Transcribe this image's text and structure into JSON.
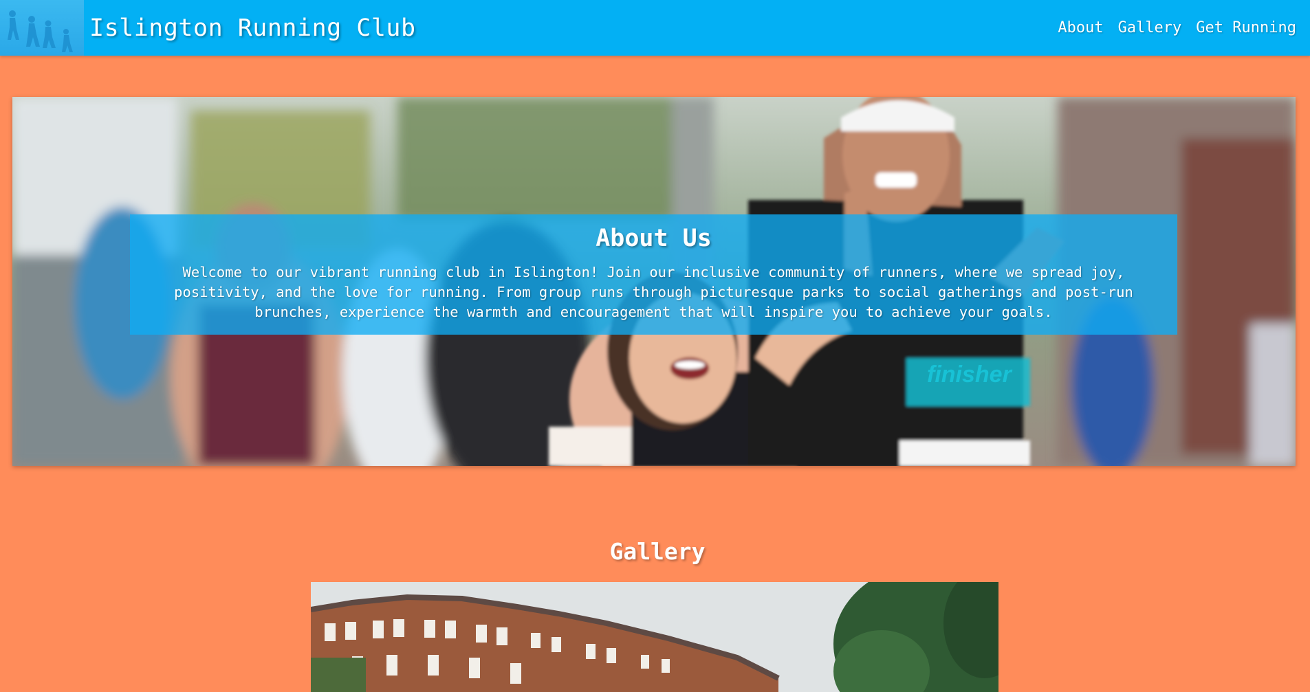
{
  "header": {
    "title": "Islington Running Club",
    "logo_icon": "runners-silhouette-icon",
    "nav": [
      {
        "label": "About"
      },
      {
        "label": "Gallery"
      },
      {
        "label": "Get Running"
      }
    ]
  },
  "about": {
    "heading": "About Us",
    "text": "Welcome to our vibrant running club in Islington! Join our inclusive community of runners, where we spread joy, positivity, and the love for running. From group runs through picturesque parks to social gatherings and post-run brunches, experience the warmth and encouragement that will inspire you to achieve your goals.",
    "hero_image": "smiling-marathon-runners-photo",
    "hero_bib_text": "finisher"
  },
  "gallery": {
    "heading": "Gallery",
    "image": "islington-terraced-houses-photo"
  },
  "colors": {
    "page_background": "#ff8c5a",
    "header_background": "#03b0f4",
    "about_box": "#10acf4",
    "text": "#ffffff"
  }
}
